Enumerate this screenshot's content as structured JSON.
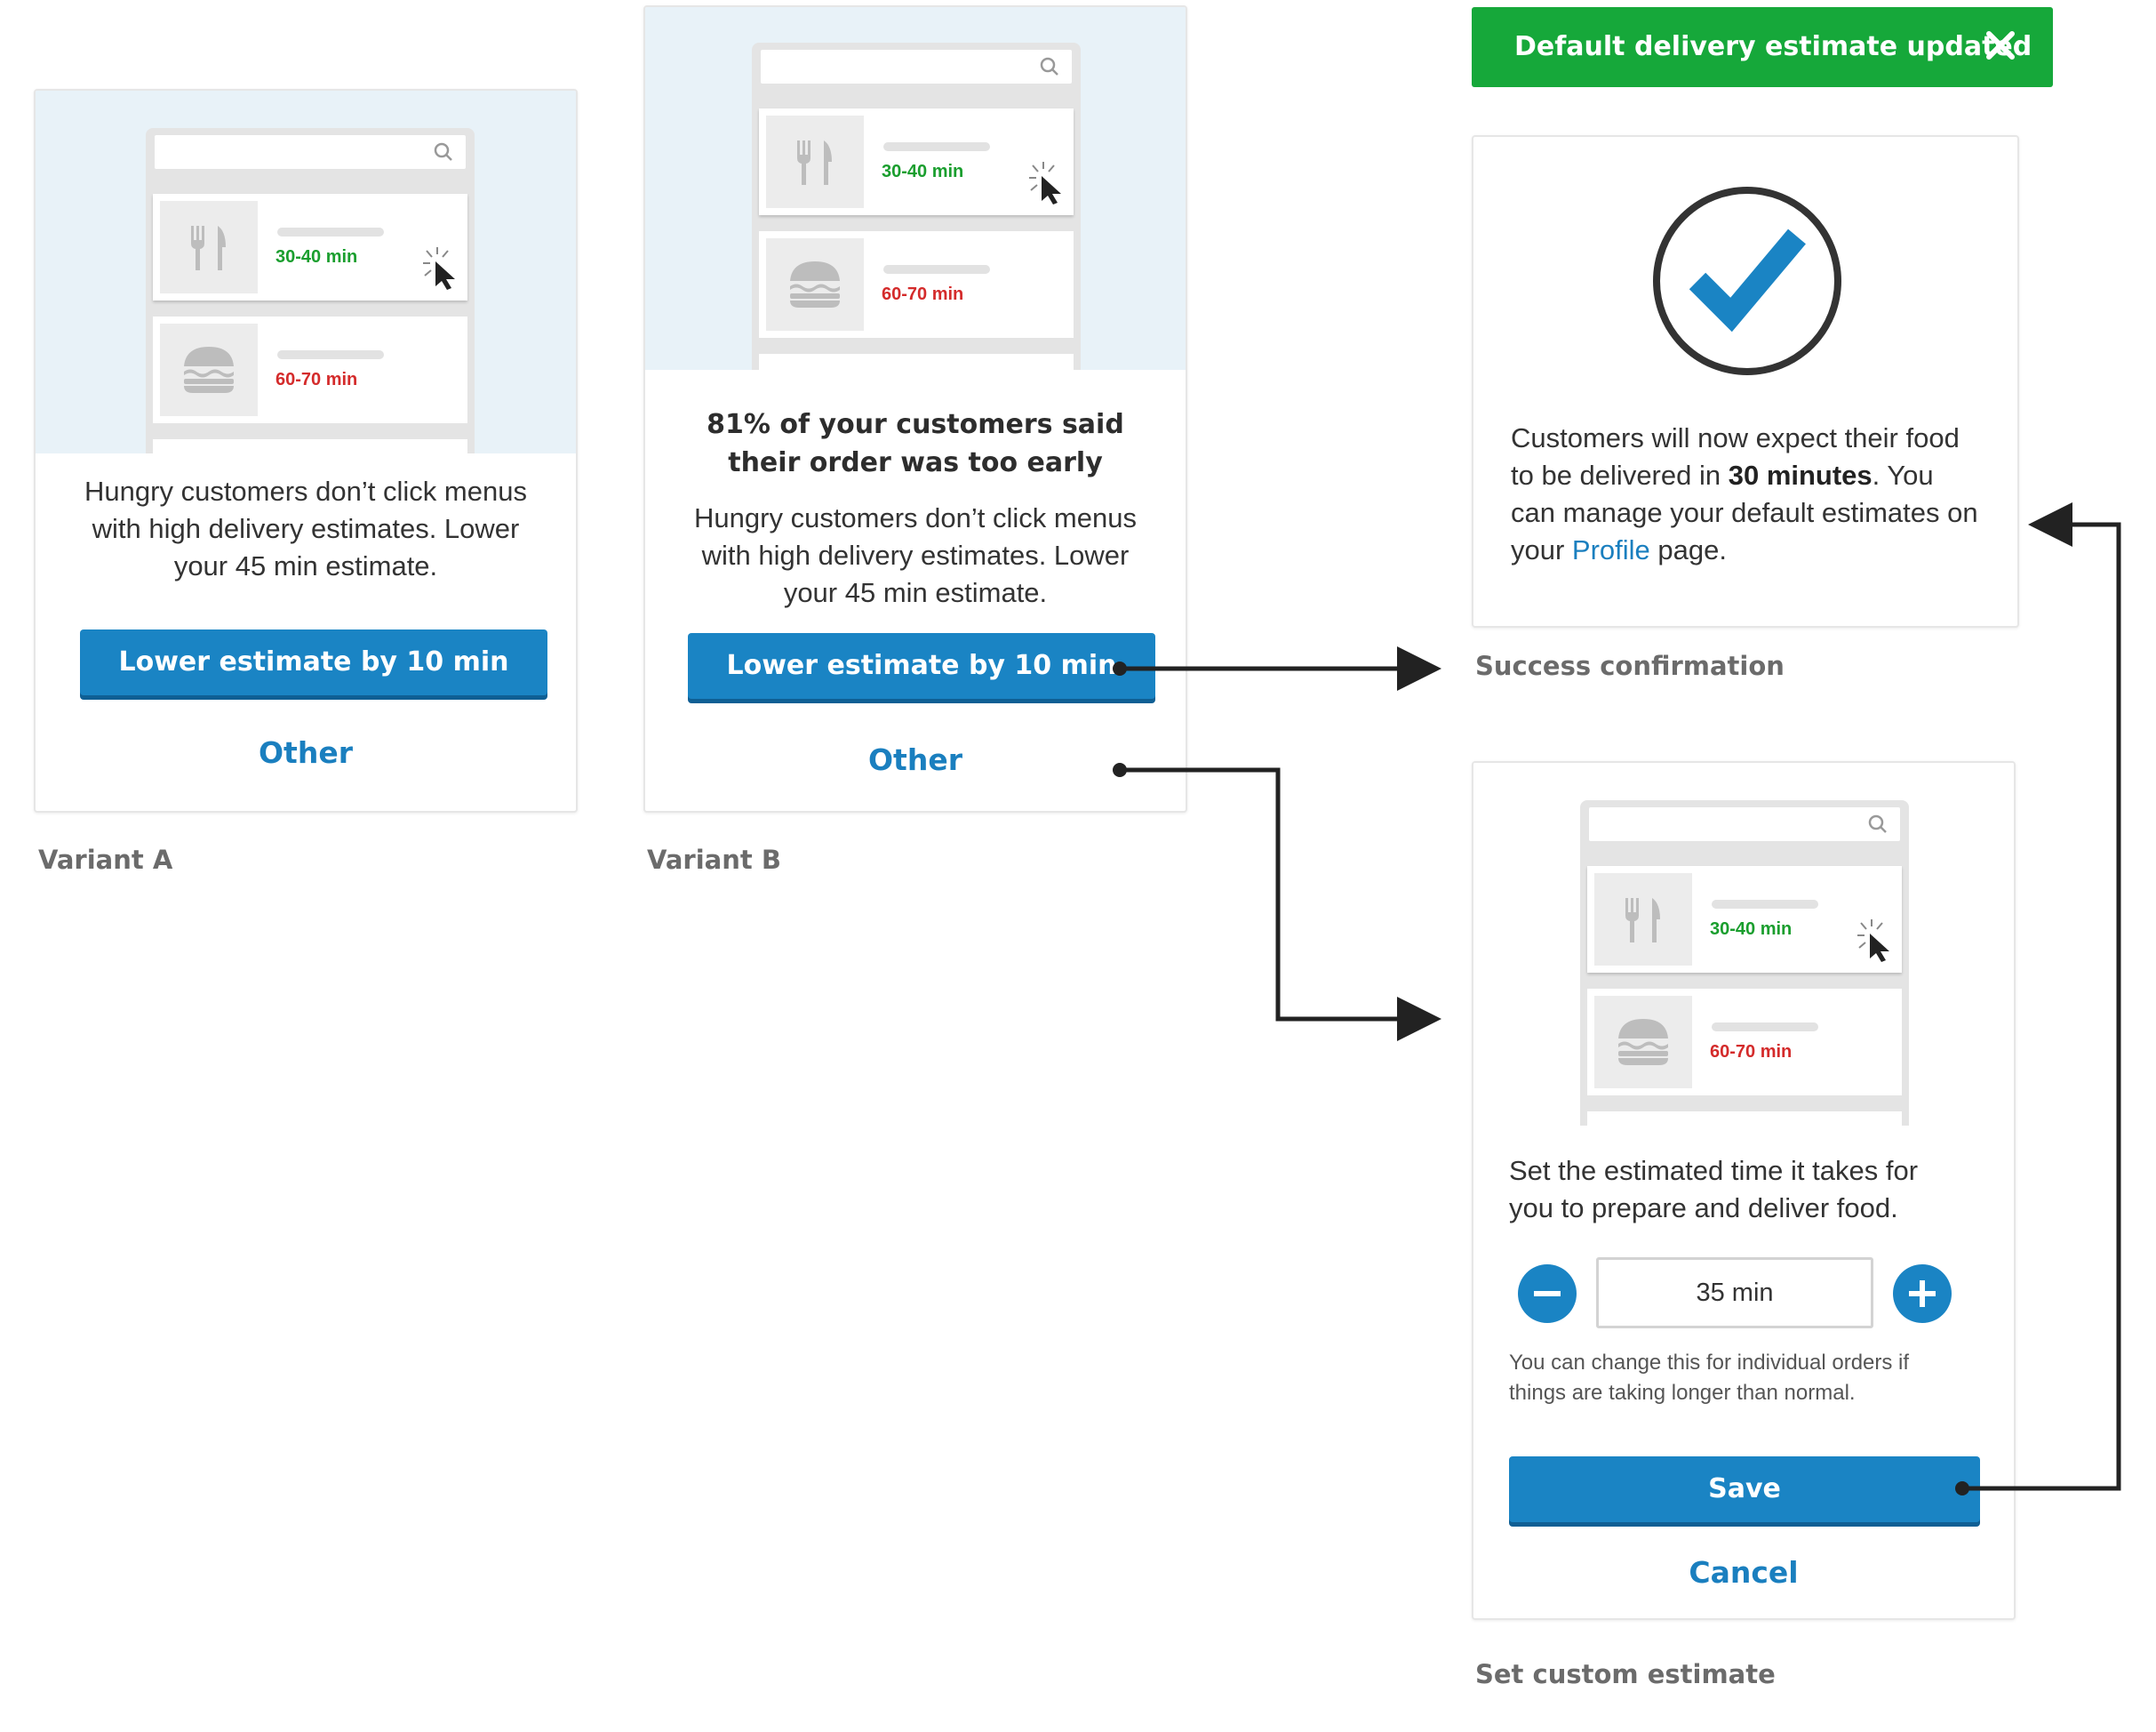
{
  "illustration": {
    "row1_time": "30-40 min",
    "row2_time": "60-70 min",
    "row1_color": "#1a9e2e",
    "row2_color": "#d42b2b"
  },
  "variant_a": {
    "body": "Hungry customers don’t click menus with high delivery estimates. Lower your 45 min estimate.",
    "primary_button": "Lower estimate by 10 min",
    "secondary_button": "Other",
    "caption": "Variant A"
  },
  "variant_b": {
    "headline": "81% of your customers said their order was too early",
    "body": "Hungry customers don’t click menus with high delivery estimates. Lower your 45 min estimate.",
    "primary_button": "Lower estimate by 10 min",
    "secondary_button": "Other",
    "caption": "Variant B"
  },
  "toast": {
    "message": "Default delivery estimate updated",
    "icon": "close-icon"
  },
  "success": {
    "text_1": "Customers will now expect their food to be delivered in ",
    "text_bold": "30 minutes",
    "text_2": ". You can manage your default estimates on your ",
    "link": "Profile",
    "text_3": " page.",
    "caption": "Success confirmation",
    "icon": "checkmark-circle-icon"
  },
  "custom": {
    "instruction": "Set the estimated time it takes for you to prepare and deliver food.",
    "value": "35 min",
    "hint": "You can change this for individual orders if things are taking longer than normal.",
    "save_button": "Save",
    "cancel_button": "Cancel",
    "caption": "Set custom estimate"
  },
  "colors": {
    "accent": "#1a84c4",
    "success": "#16a83a",
    "link": "#1a7fbf"
  }
}
